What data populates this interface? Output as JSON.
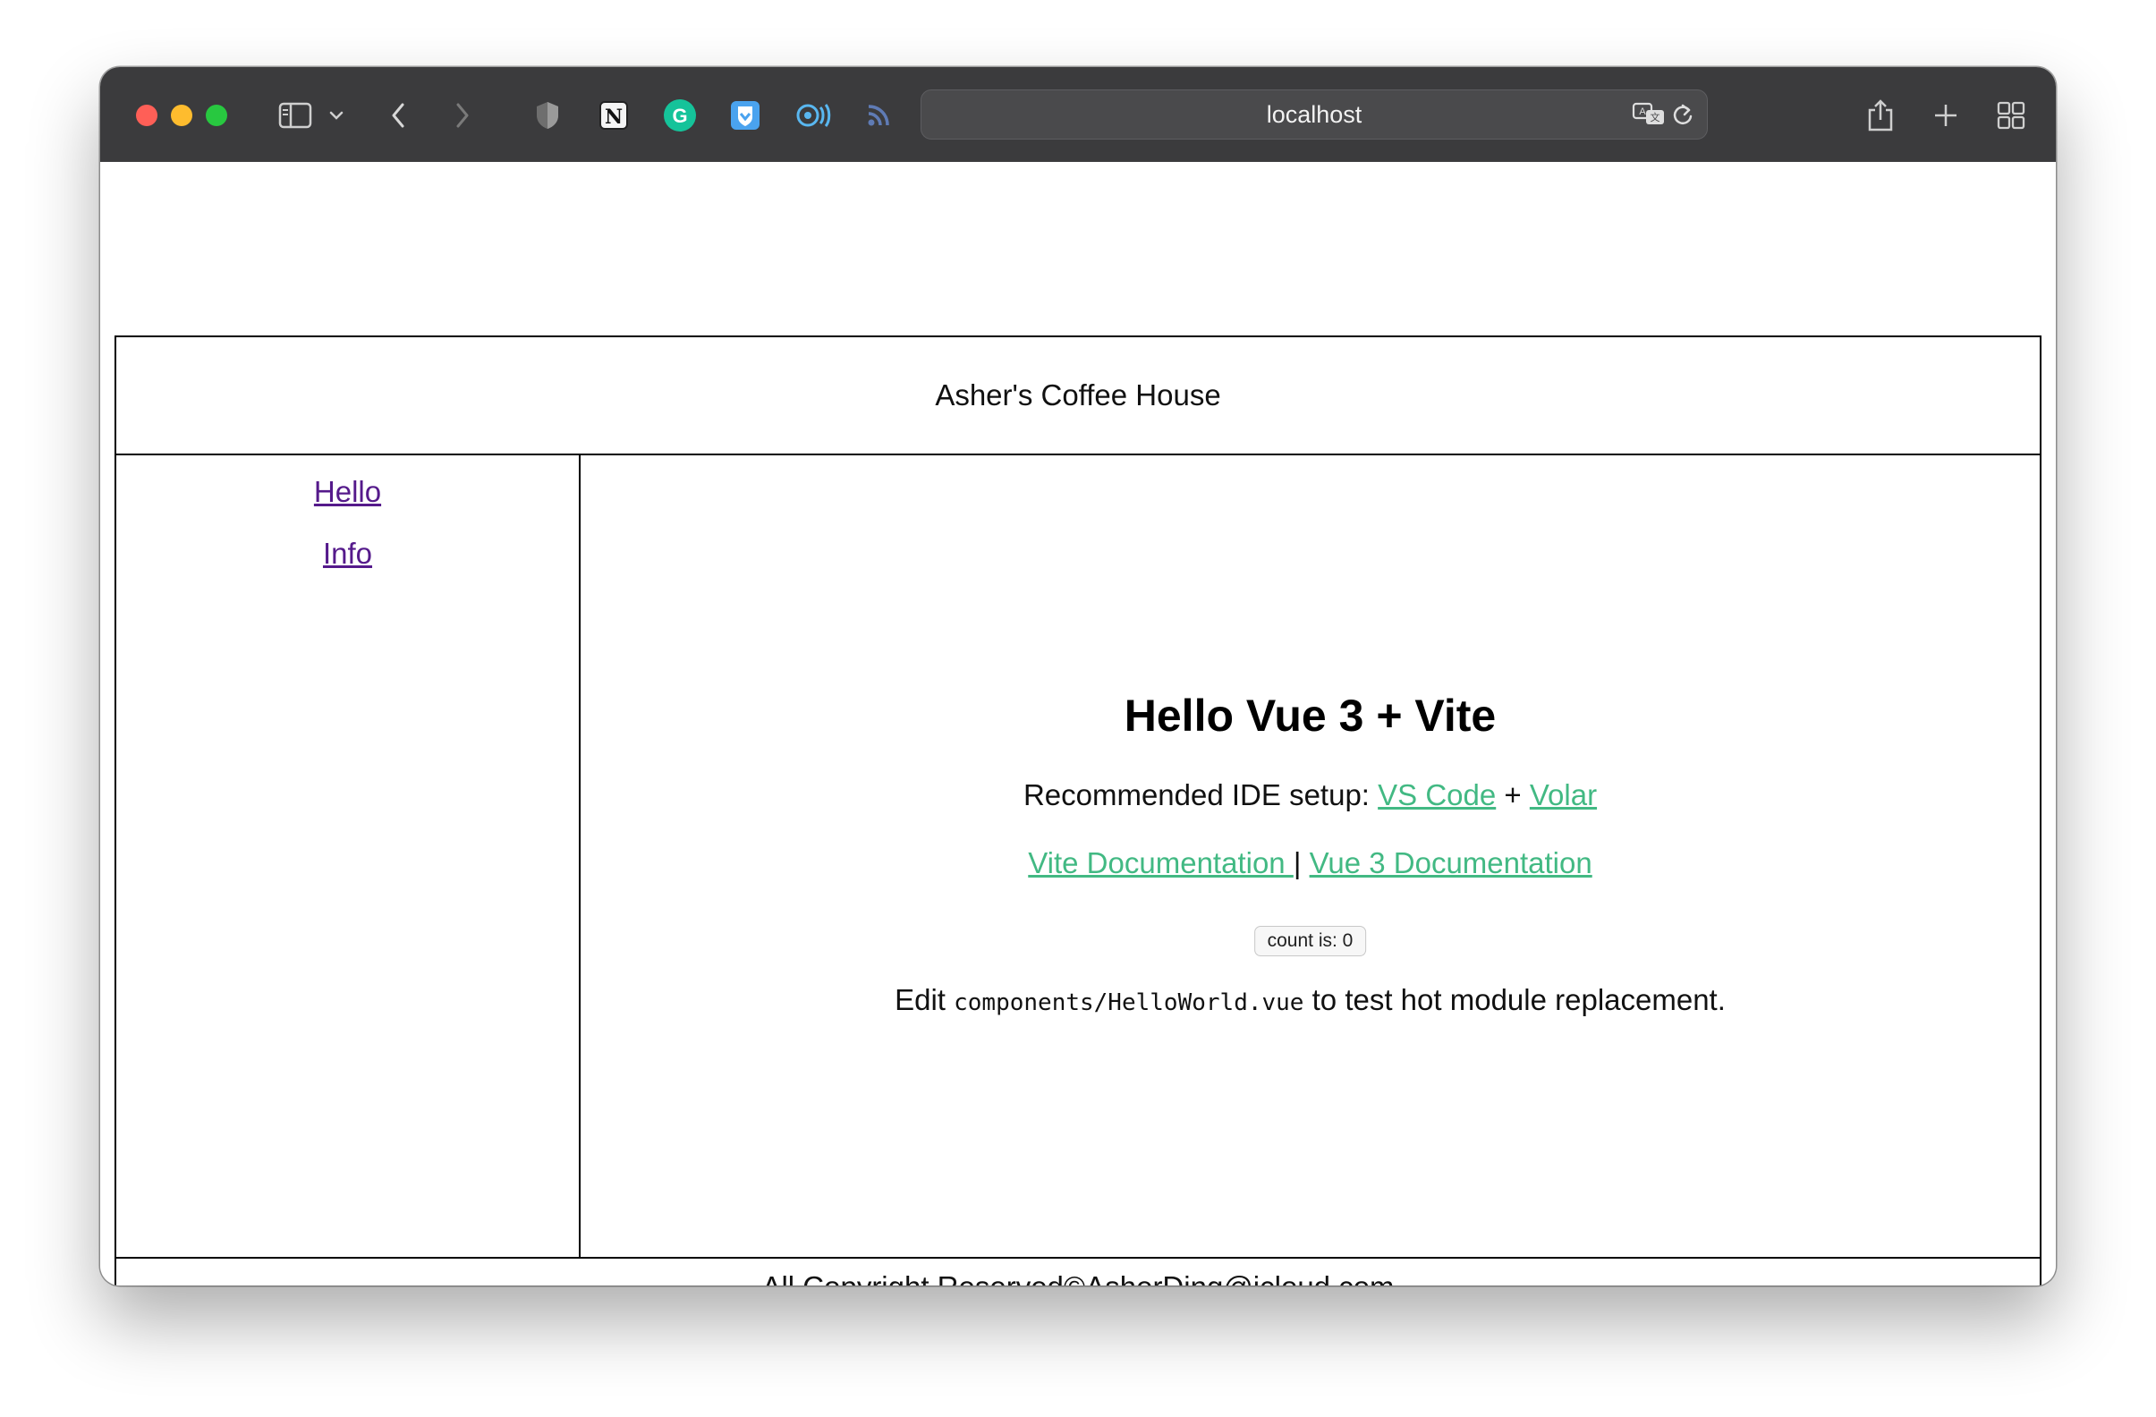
{
  "browser": {
    "url": "localhost",
    "accent_dark": "#3b3b3d",
    "extensions": [
      "privacy-shield-icon",
      "notion-icon",
      "grammarly-icon",
      "bitwarden-icon",
      "accessibility-icon",
      "rss-icon"
    ]
  },
  "app": {
    "header_title": "Asher's Coffee House",
    "nav": [
      {
        "label": "Hello"
      },
      {
        "label": "Info"
      }
    ],
    "main": {
      "heading": "Hello Vue 3 + Vite",
      "ide_prefix": "Recommended IDE setup: ",
      "ide_link_vscode": "VS Code",
      "ide_plus": " + ",
      "ide_link_volar": "Volar",
      "docs_vite": "Vite Documentation ",
      "docs_separator": "|",
      "docs_vue": "Vue 3 Documentation",
      "counter_label": "count is: 0",
      "edit_prefix": "Edit ",
      "edit_code": "components/HelloWorld.vue",
      "edit_suffix": " to test hot module replacement."
    },
    "footer": "All Copyright Reserved©AsherDing@icloud.com",
    "link_color": "#42b983",
    "visited_link_color": "#551a8b"
  }
}
